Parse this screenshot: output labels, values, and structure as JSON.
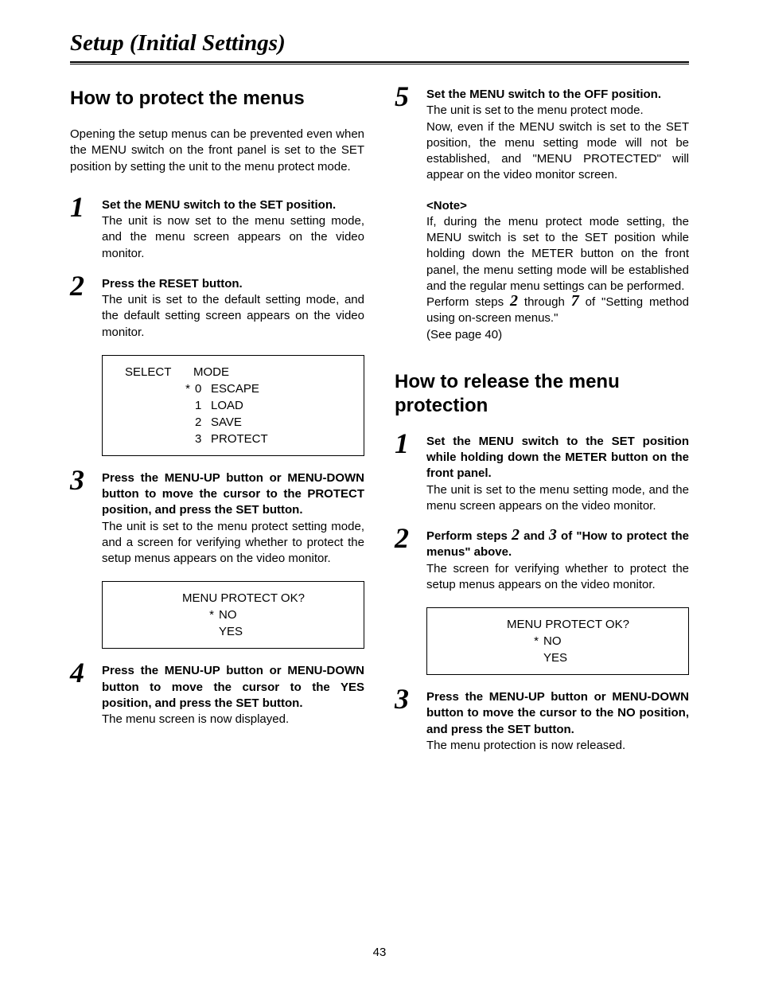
{
  "page_title": "Setup (Initial Settings)",
  "page_number": "43",
  "left": {
    "heading": "How to protect the menus",
    "intro": "Opening the setup menus can be prevented even when the MENU switch on the front panel is set to the SET position by setting the unit to the menu protect mode.",
    "step1_num": "1",
    "step1_lead": "Set the MENU switch to the SET position.",
    "step1_desc": "The unit is now set to the menu setting mode, and the menu screen appears on the video monitor.",
    "step2_num": "2",
    "step2_lead": "Press the RESET button.",
    "step2_desc": "The unit is set to the default setting mode, and the default setting screen appears on the video monitor.",
    "screen1": {
      "h1": "SELECT",
      "h2": "MODE",
      "marker": "*",
      "r0n": "0",
      "r0l": "ESCAPE",
      "r1n": "1",
      "r1l": "LOAD",
      "r2n": "2",
      "r2l": "SAVE",
      "r3n": "3",
      "r3l": "PROTECT"
    },
    "step3_num": "3",
    "step3_lead": "Press the MENU-UP button or MENU-DOWN button to move the cursor to the PROTECT position, and press the SET button.",
    "step3_desc": "The unit is set to the menu protect setting mode, and a screen for verifying whether to protect the setup menus appears on the video monitor.",
    "screen2": {
      "title": "MENU PROTECT OK?",
      "marker": "*",
      "o1": "NO",
      "o2": "YES"
    },
    "step4_num": "4",
    "step4_lead": "Press the MENU-UP button or MENU-DOWN button to move the cursor to the YES position, and press the SET button.",
    "step4_desc": "The menu screen is now displayed."
  },
  "right": {
    "step5_num": "5",
    "step5_lead": "Set the MENU switch to the OFF position.",
    "step5_d1": "The unit is set to the menu protect mode.",
    "step5_d2": "Now, even if the MENU switch is set to the SET position, the menu setting mode will not be established, and \"MENU PROTECTED\" will appear on the video monitor screen.",
    "note_head": "<Note>",
    "note_p1": "If, during the menu protect mode setting, the MENU switch is set to the SET position while holding down the METER button on the front panel, the menu setting mode will be established and the regular menu settings can be performed.",
    "note_p2a": "Perform steps ",
    "note_p2_n1": "2",
    "note_p2b": " through ",
    "note_p2_n2": "7",
    "note_p2c": " of \"Setting method using on-screen menus.\"",
    "note_p3": "(See page 40)",
    "heading": "How to release the menu protection",
    "r_step1_num": "1",
    "r_step1_lead": "Set the MENU switch to the SET position while holding down the METER button on the front panel.",
    "r_step1_desc": "The unit is set to the menu setting mode, and the menu screen appears on the video monitor.",
    "r_step2_num": "2",
    "r_step2_lead_a": "Perform steps ",
    "r_step2_lead_n1": "2",
    "r_step2_lead_b": " and ",
    "r_step2_lead_n2": "3",
    "r_step2_lead_c": " of \"How to protect the menus\" above.",
    "r_step2_desc": "The screen for verifying whether to protect the setup menus appears on the video monitor.",
    "screen3": {
      "title": "MENU PROTECT OK?",
      "marker": "*",
      "o1": "NO",
      "o2": "YES"
    },
    "r_step3_num": "3",
    "r_step3_lead": "Press the MENU-UP button or MENU-DOWN button to move the cursor to the NO position, and press the SET button.",
    "r_step3_desc": "The menu protection is now released."
  }
}
